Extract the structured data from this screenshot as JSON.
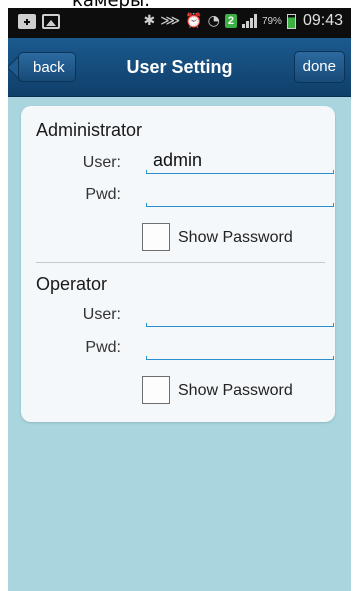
{
  "overlay_text": "камеры.",
  "status_bar": {
    "battery_percent": "79%",
    "time": "09:43",
    "sim_badge": "2",
    "icons": [
      "plus-icon",
      "image-icon",
      "bluetooth-icon",
      "mute-icon",
      "alarm-icon",
      "wifi-icon",
      "signal-icon",
      "battery-icon"
    ]
  },
  "nav": {
    "title": "User Setting",
    "back_label": "back",
    "done_label": "done"
  },
  "sections": [
    {
      "title": "Administrator",
      "user_label": "User:",
      "user_value": "admin",
      "pwd_label": "Pwd:",
      "pwd_value": "",
      "show_password_label": "Show Password",
      "show_password_checked": false
    },
    {
      "title": "Operator",
      "user_label": "User:",
      "user_value": "",
      "pwd_label": "Pwd:",
      "pwd_value": "",
      "show_password_label": "Show Password",
      "show_password_checked": false
    }
  ],
  "colors": {
    "background": "#a9d6de",
    "navbar": "#174b78",
    "field_underline": "#2e8fd0",
    "card": "#f4f8fa"
  }
}
